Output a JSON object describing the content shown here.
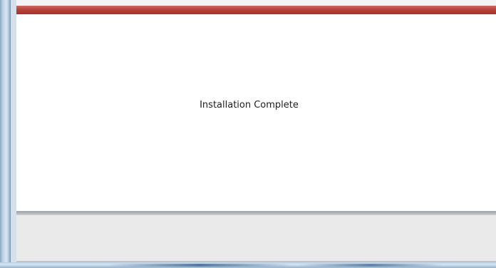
{
  "dialog": {
    "message": "Installation Complete"
  },
  "colors": {
    "title_accent": "#b8433d",
    "frame": "#a8bfd6",
    "footer": "#eaeaea"
  }
}
